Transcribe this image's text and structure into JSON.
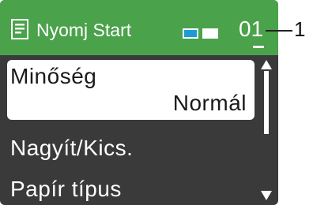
{
  "header": {
    "icon": "document-icon",
    "title": "Nyomj Start",
    "ink_indicators": [
      "color-ink",
      "mono-ink"
    ],
    "copies": "01"
  },
  "menu": {
    "items": [
      {
        "label": "Minőség",
        "value": "Normál",
        "selected": true
      },
      {
        "label": "Nagyít/Kics."
      },
      {
        "label": "Papír típus"
      }
    ]
  },
  "scrollbar": {
    "up_icon": "scroll-up-arrow-icon",
    "down_icon": "scroll-down-arrow-icon"
  },
  "callout": {
    "number": "1"
  },
  "colors": {
    "header_bg": "#4aa24a",
    "screen_bg": "#3a3a3a",
    "color_ink": "#1e9bd7"
  }
}
